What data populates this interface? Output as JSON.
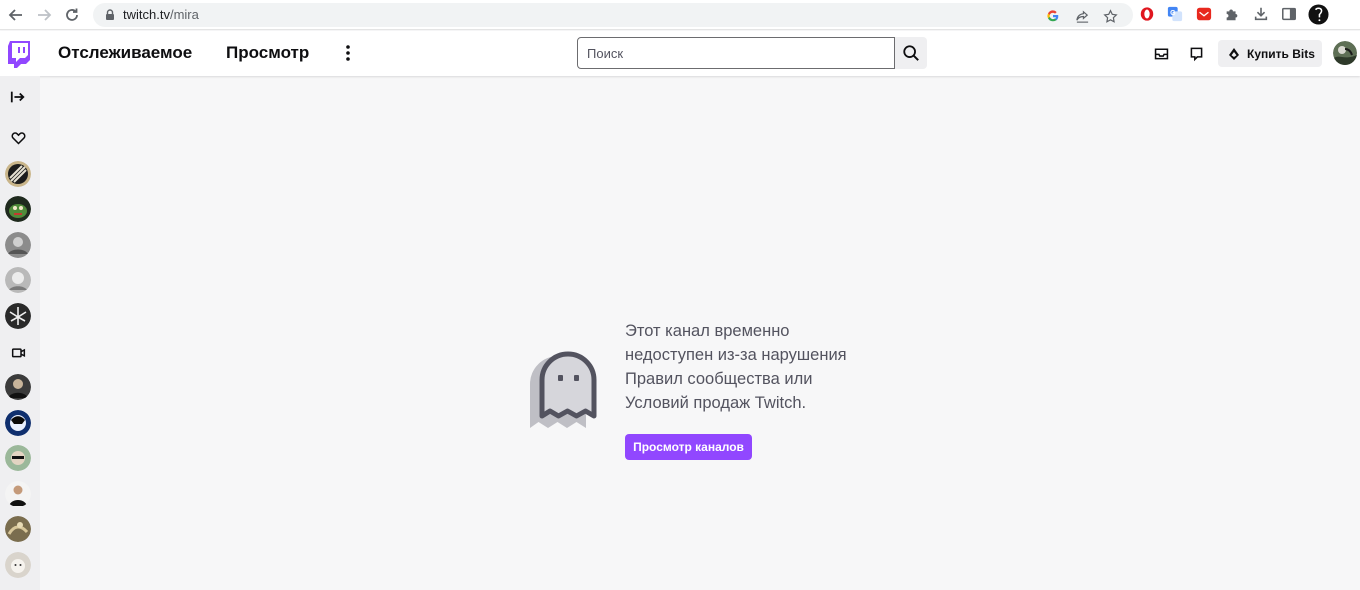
{
  "browser": {
    "url_host": "twitch.tv",
    "url_path": "/mira"
  },
  "nav": {
    "following": "Отслеживаемое",
    "browse": "Просмотр",
    "search_placeholder": "Поиск",
    "buy_bits": "Купить Bits"
  },
  "main": {
    "message": "Этот канал временно недоступен из-за нарушения Правил сообщества или Условий продаж Twitch.",
    "browse_button": "Просмотр каналов"
  },
  "colors": {
    "brand": "#9147ff",
    "sidebar_bg": "#efeff1",
    "page_bg": "#f7f7f8",
    "ghost_body": "#bfbfc5",
    "ghost_outline": "#53535f"
  },
  "icons": {
    "sidebar": [
      "expand-arrow-icon",
      "heart-icon",
      "video-camera-icon"
    ],
    "top": [
      "inbox-icon",
      "whispers-icon",
      "bits-icon"
    ]
  }
}
